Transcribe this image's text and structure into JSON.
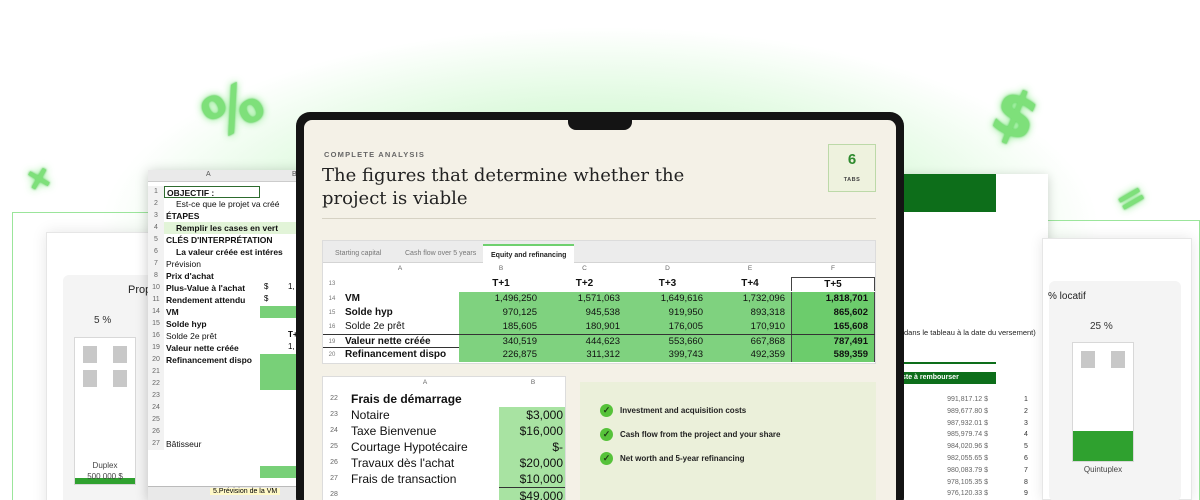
{
  "decor": {
    "percent": "%",
    "dollar": "$",
    "plus": "+",
    "equals": "="
  },
  "left_card": {
    "title": "Prop",
    "percent": "5 %",
    "house_label": "Duplex",
    "house_value": "500 000 $"
  },
  "right_card": {
    "title": "% locatif",
    "percent": "25 %",
    "house_label": "Quintuplex"
  },
  "sheet": {
    "col_a": "A",
    "col_b": "B",
    "rows": [
      {
        "n": "1",
        "t": "OBJECTIF :",
        "bold": true
      },
      {
        "n": "2",
        "t": "Est-ce que le projet va créé",
        "bold": false
      },
      {
        "n": "3",
        "t": "ÉTAPES",
        "bold": true
      },
      {
        "n": "4",
        "t": "Remplir les cases en vert",
        "bold": true
      },
      {
        "n": "5",
        "t": "CLÉS D'INTERPRÉTATION",
        "bold": true
      },
      {
        "n": "6",
        "t": "La valeur créée est intéres",
        "bold": true
      },
      {
        "n": "7",
        "t": "Prévision",
        "bold": false
      },
      {
        "n": "8",
        "t": "Prix d'achat",
        "bold": true
      },
      {
        "n": "10",
        "t": "Plus-Value à l'achat",
        "bold": true
      },
      {
        "n": "11",
        "t": "Rendement attendu",
        "bold": true
      },
      {
        "n": "14",
        "t": "VM",
        "bold": true
      },
      {
        "n": "15",
        "t": "Solde hyp",
        "bold": true
      },
      {
        "n": "16",
        "t": "Solde 2e prêt",
        "bold": false
      },
      {
        "n": "19",
        "t": "Valeur nette créée",
        "bold": true
      },
      {
        "n": "20",
        "t": "Refinancement dispo",
        "bold": true
      },
      {
        "n": "21",
        "t": "",
        "bold": false
      },
      {
        "n": "22",
        "t": "",
        "bold": false
      },
      {
        "n": "23",
        "t": "",
        "bold": false
      },
      {
        "n": "24",
        "t": "",
        "bold": false
      },
      {
        "n": "25",
        "t": "",
        "bold": false
      },
      {
        "n": "26",
        "t": "",
        "bold": false
      },
      {
        "n": "27",
        "t": "Bâtisseur",
        "bold": false
      }
    ],
    "dollar": "$",
    "price_partial": "1,",
    "header_partial": "T+",
    "vm_partial": "1,",
    "tab_label": "5.Prévision de la VM"
  },
  "doc": {
    "note": "dans le tableau à la date du versement)",
    "repay_label": "ste à rembourser",
    "amounts": [
      "991,817.12 $",
      "989,677.80 $",
      "987,932.01 $",
      "985,979.74 $",
      "984,020.96 $",
      "982,055.65 $",
      "980,083.79 $",
      "978,105.35 $",
      "976,120.33 $"
    ],
    "numbers": [
      "1",
      "2",
      "3",
      "4",
      "5",
      "6",
      "7",
      "8",
      "9"
    ]
  },
  "laptop": {
    "eyebrow": "COMPLETE ANALYSIS",
    "headline": "The figures that determine whether the project is viable",
    "tabs_count": "6",
    "tabs_label": "TABS",
    "sheet_tabs": [
      "Starting capital",
      "Cash flow over 5 years",
      "Equity and refinancing"
    ],
    "active_tab": 2,
    "columns": [
      "A",
      "B",
      "C",
      "D",
      "E",
      "F"
    ],
    "header_row": {
      "n": "13",
      "cells": [
        "T+1",
        "T+2",
        "T+3",
        "T+4",
        "T+5"
      ]
    },
    "rows": [
      {
        "n": "14",
        "label": "VM",
        "cells": [
          "1,496,250",
          "1,571,063",
          "1,649,616",
          "1,732,096",
          "1,818,701"
        ],
        "bold": true
      },
      {
        "n": "15",
        "label": "Solde hyp",
        "cells": [
          "970,125",
          "945,538",
          "919,950",
          "893,318",
          "865,602"
        ],
        "bold": true
      },
      {
        "n": "16",
        "label": "Solde 2e prêt",
        "cells": [
          "185,605",
          "180,901",
          "176,005",
          "170,910",
          "165,608"
        ],
        "bold": false
      },
      {
        "n": "19",
        "label": "Valeur nette créée",
        "cells": [
          "340,519",
          "444,623",
          "553,660",
          "667,868",
          "787,491"
        ],
        "bold": true
      },
      {
        "n": "20",
        "label": "Refinancement dispo",
        "cells": [
          "226,875",
          "311,312",
          "399,743",
          "492,359",
          "589,359"
        ],
        "bold": true
      }
    ],
    "bottom_columns": [
      "A",
      "B"
    ],
    "bottom_rows": [
      {
        "n": "22",
        "label": "Frais de démarrage",
        "value": "",
        "bold": true
      },
      {
        "n": "23",
        "label": "Notaire",
        "value": "$3,000",
        "bold": false
      },
      {
        "n": "24",
        "label": "Taxe Bienvenue",
        "value": "$16,000",
        "bold": false
      },
      {
        "n": "25",
        "label": "Courtage Hypotécaire",
        "value": "$-",
        "bold": false
      },
      {
        "n": "26",
        "label": "Travaux dès l'achat",
        "value": "$20,000",
        "bold": false
      },
      {
        "n": "27",
        "label": "Frais de transaction",
        "value": "$10,000",
        "bold": false
      },
      {
        "n": "28",
        "label": "",
        "value": "$49,000",
        "bold": false
      }
    ],
    "checklist": [
      "Investment and acquisition costs",
      "Cash flow from the project and your share",
      "Net worth and 5-year refinancing"
    ],
    "check_glyph": "✓"
  }
}
